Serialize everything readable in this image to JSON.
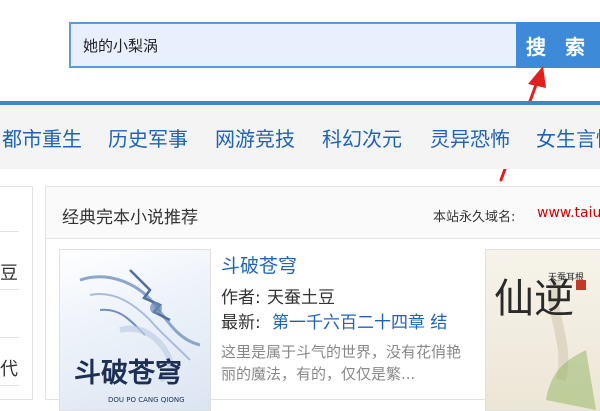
{
  "search": {
    "value": "她的小梨涡",
    "button_label": "搜 索"
  },
  "nav": {
    "items": [
      "都市重生",
      "历史军事",
      "网游竞技",
      "科幻次元",
      "灵异恐怖",
      "女生言情"
    ]
  },
  "sidebar": {
    "fragments": [
      "豆",
      "代"
    ]
  },
  "panel": {
    "title": "经典完本小说推荐",
    "domain_label": "本站永久域名:",
    "domain_value": "www.taiu"
  },
  "book": {
    "title": "斗破苍穹",
    "author_label": "作者:",
    "author": "天蚕土豆",
    "latest_label": "最新:",
    "latest": "第一千六百二十四章 结",
    "description": "这里是属于斗气的世界，没有花俏艳丽的魔法，有的，仅仅是繁..."
  },
  "covers": {
    "book1": {
      "main": "斗破苍穹",
      "sub": "DOU PO CANG QIONG"
    },
    "book2": {
      "main": "仙逆",
      "sub": "天蚕耳根"
    }
  },
  "colors": {
    "accent": "#3c8ad8",
    "link": "#1d63b8",
    "domain": "#d60000",
    "annotation": "#e02020"
  }
}
